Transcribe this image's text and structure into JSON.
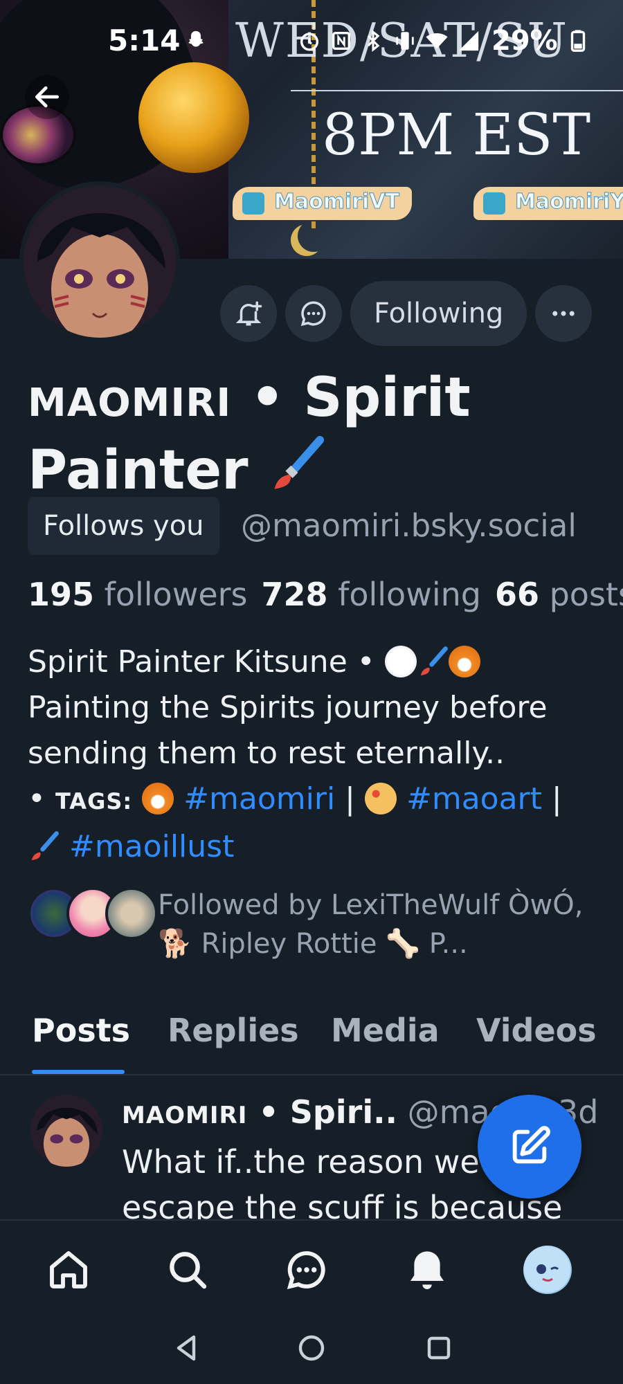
{
  "status_bar": {
    "time": "5:14",
    "battery": "29%"
  },
  "banner": {
    "schedule_days": "WED/SAT/SU",
    "schedule_time": "8PM EST",
    "twitch_handle": "MaomiriVT",
    "youtube_handle": "MaomiriY"
  },
  "profile": {
    "display_name_caps": "MAOMIRI",
    "display_name_rest": " • Spirit Painter",
    "follows_you_label": "Follows you",
    "handle": "@maomiri.bsky.social",
    "followers_count": "195",
    "followers_label": "followers",
    "following_count": "728",
    "following_label": "following",
    "posts_count": "66",
    "posts_label": "posts",
    "bio_line1": "Spirit Painter Kitsune • ",
    "bio_line2": "Painting the Spirits journey before sending them to rest eternally..",
    "bio_tags_bullet": "• ",
    "bio_tags_label": "TAGS:",
    "tag1": "#maomiri",
    "tag2": "#maoart",
    "tag3": "#maoillust",
    "followed_by": "Followed by LexiTheWulf ÒwÓ, 🐕 Ripley Rottie 🦴 P..."
  },
  "actions": {
    "following_label": "Following"
  },
  "tabs": [
    {
      "label": "Posts"
    },
    {
      "label": "Replies"
    },
    {
      "label": "Media"
    },
    {
      "label": "Videos"
    }
  ],
  "post": {
    "author_caps": "MAOMIRI",
    "author_rest": " • Spiri..",
    "handle": " @mao",
    "age": "3d",
    "text": "What if..the reason we can't escape the scuff is because"
  },
  "colors": {
    "accent": "#2f8dff",
    "background": "#161e27",
    "surface": "#27313d"
  }
}
